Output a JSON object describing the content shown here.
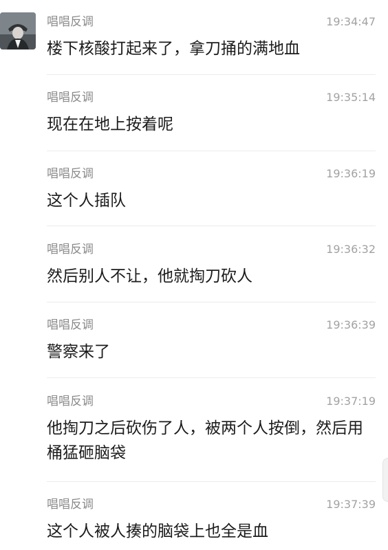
{
  "messages": [
    {
      "sender": "唱唱反调",
      "time": "19:34:47",
      "text": "楼下核酸打起来了，拿刀捅的满地血"
    },
    {
      "sender": "唱唱反调",
      "time": "19:35:14",
      "text": "现在在地上按着呢"
    },
    {
      "sender": "唱唱反调",
      "time": "19:36:19",
      "text": "这个人插队"
    },
    {
      "sender": "唱唱反调",
      "time": "19:36:32",
      "text": "然后别人不让，他就掏刀砍人"
    },
    {
      "sender": "唱唱反调",
      "time": "19:36:39",
      "text": "警察来了"
    },
    {
      "sender": "唱唱反调",
      "time": "19:37:19",
      "text": "他掏刀之后砍伤了人，被两个人按倒，然后用桶猛砸脑袋"
    },
    {
      "sender": "唱唱反调",
      "time": "19:37:39",
      "text": "这个人被人揍的脑袋上也全是血"
    }
  ]
}
